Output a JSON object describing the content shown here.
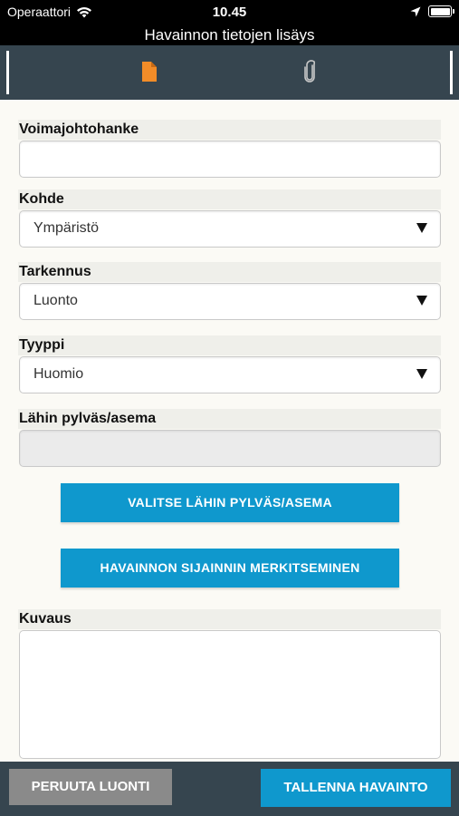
{
  "status_bar": {
    "carrier": "Operaattori",
    "time": "10.45",
    "icons": [
      "wifi-icon",
      "location-arrow-icon",
      "battery-icon"
    ]
  },
  "title": "Havainnon tietojen lisäys",
  "tabs": [
    {
      "icon": "document-icon",
      "active": true,
      "color": "#f28c28"
    },
    {
      "icon": "paperclip-icon",
      "active": false,
      "color": "#c8c8c8"
    }
  ],
  "form": {
    "voimajohtohanke": {
      "label": "Voimajohtohanke",
      "value": ""
    },
    "kohde": {
      "label": "Kohde",
      "value": "Ympäristö"
    },
    "tarkennus": {
      "label": "Tarkennus",
      "value": "Luonto"
    },
    "tyyppi": {
      "label": "Tyyppi",
      "value": "Huomio"
    },
    "lahin": {
      "label": "Lähin pylväs/asema",
      "value": ""
    },
    "kuvaus": {
      "label": "Kuvaus",
      "value": ""
    }
  },
  "buttons": {
    "select_nearest": "VALITSE LÄHIN PYLVÄS/ASEMA",
    "mark_location": "HAVAINNON SIJAINNIN MERKITSEMINEN"
  },
  "footer": {
    "cancel": "PERUUTA LUONTI",
    "save": "TALLENNA HAVAINTO"
  },
  "colors": {
    "accent": "#0f98cd",
    "bar": "#36454f",
    "cancel": "#8a8a8a"
  }
}
